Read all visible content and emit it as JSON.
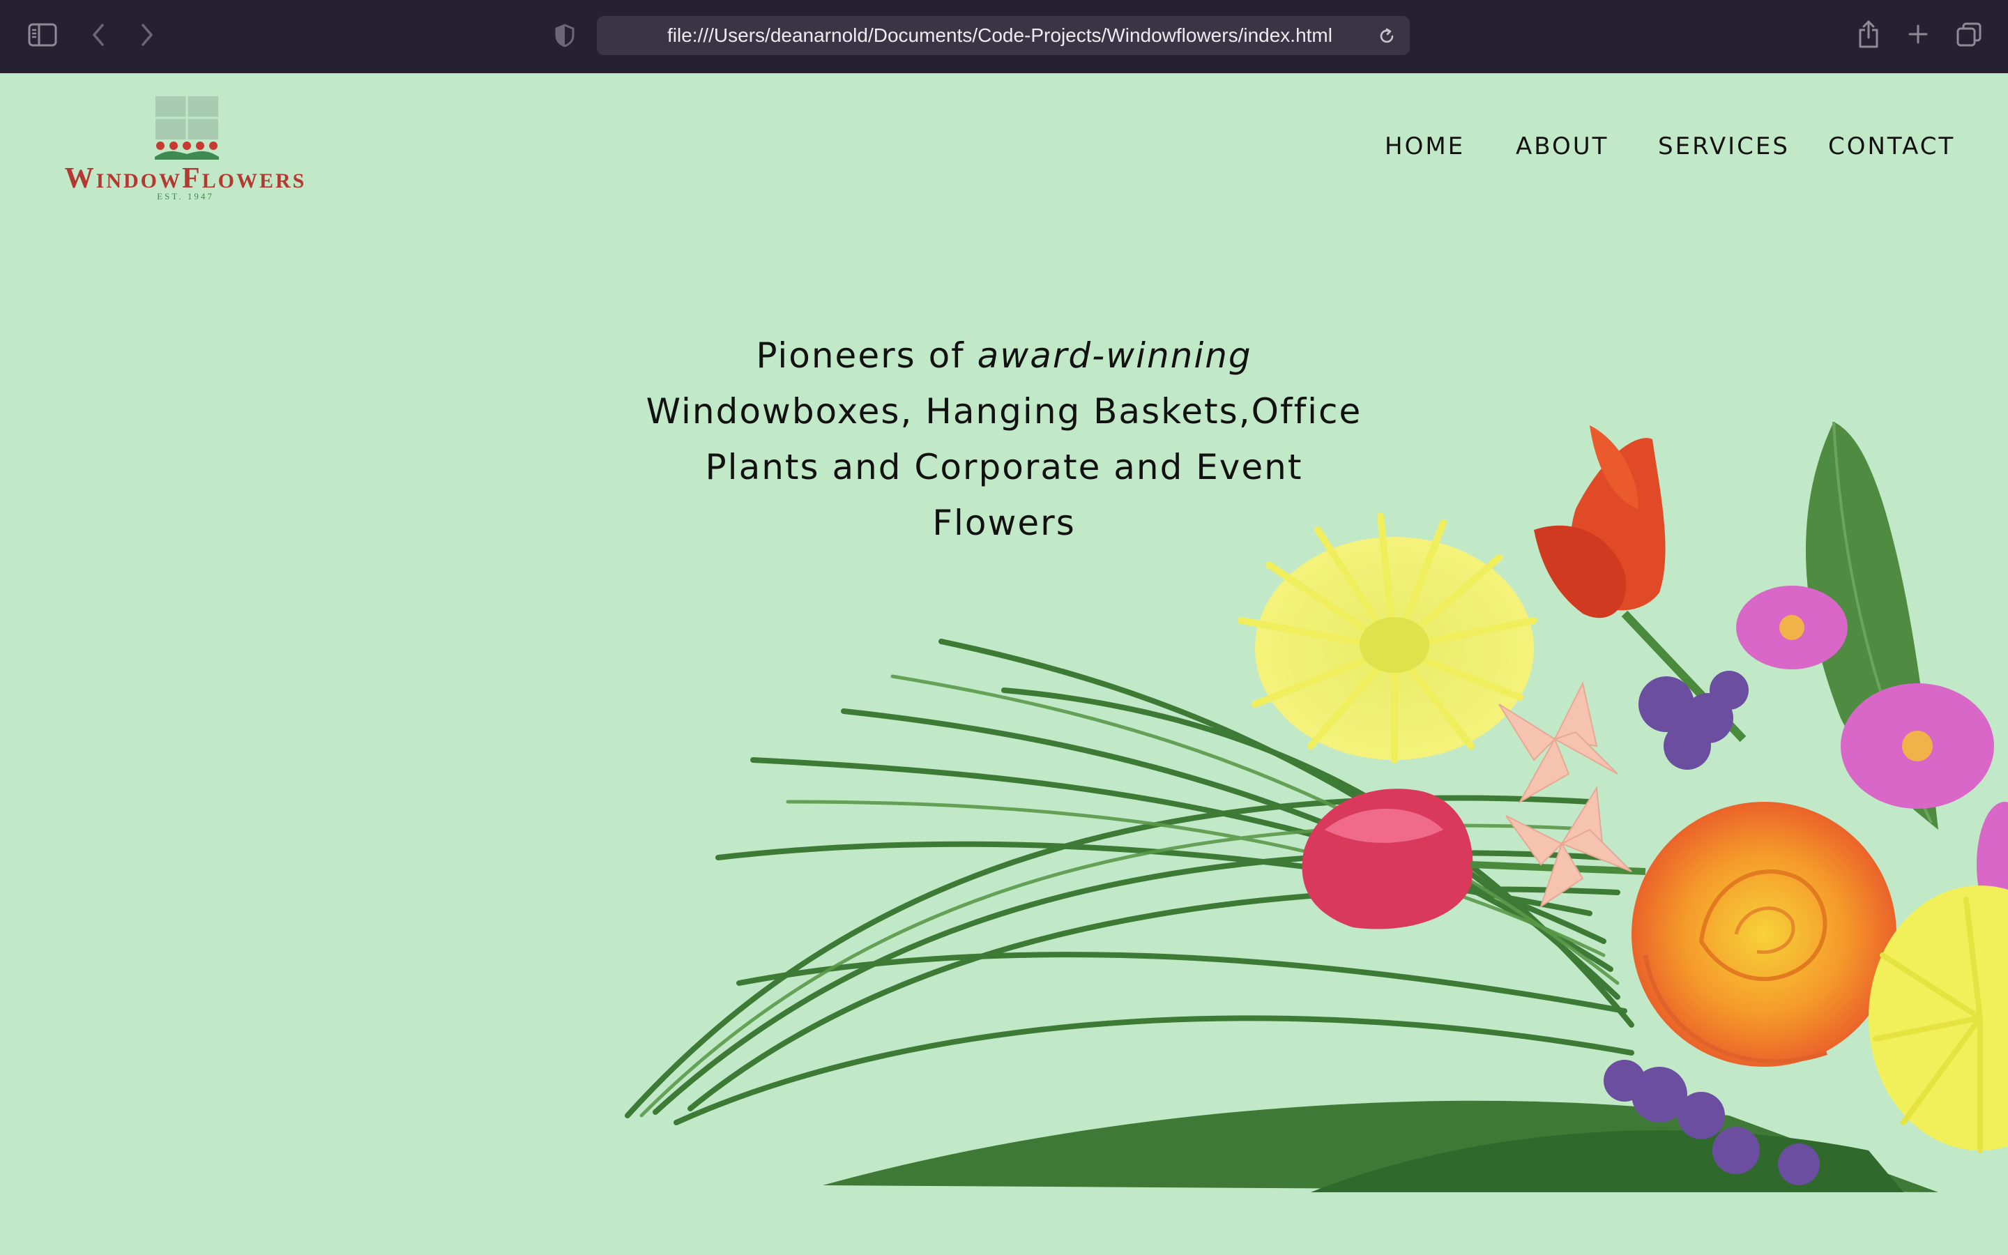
{
  "browser": {
    "url": "file:///Users/deanarnold/Documents/Code-Projects/Windowflowers/index.html",
    "icons": {
      "sidebar": "sidebar-toggle-icon",
      "back": "chevron-left-icon",
      "forward": "chevron-right-icon",
      "privacy": "shield-icon",
      "reload": "reload-icon",
      "share": "share-icon",
      "new_tab": "plus-icon",
      "tabs": "tab-overview-icon"
    }
  },
  "site": {
    "logo": {
      "name_first_letter": "W",
      "name_part1": "INDOW",
      "name_second_letter": "F",
      "name_part2": "LOWERS",
      "est": "EST. 1947"
    },
    "nav": [
      {
        "label": "HOME"
      },
      {
        "label": "ABOUT"
      },
      {
        "label": "SERVICES"
      },
      {
        "label": "CONTACT"
      }
    ],
    "hero": {
      "line1_prefix": "Pioneers of ",
      "line1_emphasis": "award-winning",
      "line2": "Windowboxes, Hanging Baskets,Office",
      "line3": "Plants and Corporate and Event",
      "line4": "Flowers"
    }
  },
  "colors": {
    "page_bg": "#c1e9c7",
    "toolbar_bg": "#262130",
    "logo_red": "#b33a32",
    "logo_green": "#3e8a52"
  }
}
